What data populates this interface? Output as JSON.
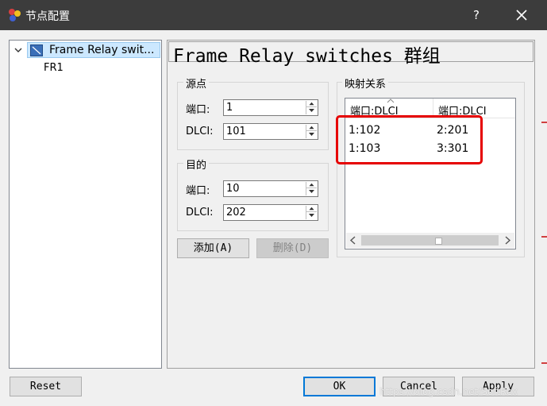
{
  "window": {
    "title": "节点配置",
    "help_label": "?"
  },
  "tree": {
    "root_label": "Frame Relay swit...",
    "child_label": "FR1"
  },
  "header": {
    "title": "Frame Relay switches 群组"
  },
  "source_group": {
    "title": "源点",
    "port_label": "端口:",
    "port_value": "1",
    "dlci_label": "DLCI:",
    "dlci_value": "101"
  },
  "dest_group": {
    "title": "目的",
    "port_label": "端口:",
    "port_value": "10",
    "dlci_label": "DLCI:",
    "dlci_value": "202"
  },
  "actions": {
    "add_label": "添加(A)",
    "delete_label": "删除(D)"
  },
  "mapping": {
    "title": "映射关系",
    "columns": [
      "端口:DLCI",
      "端口:DLCI"
    ],
    "rows": [
      [
        "1:102",
        "2:201"
      ],
      [
        "1:103",
        "3:301"
      ]
    ]
  },
  "footer": {
    "reset_label": "Reset",
    "ok_label": "OK",
    "cancel_label": "Cancel",
    "apply_label": "Apply"
  },
  "watermark": "https://blog.csdn.net/SoftRex",
  "colors": {
    "titlebar": "#3c3c3c",
    "selection": "#cce8ff",
    "highlight": "#e60000",
    "default_button_border": "#0078d7"
  }
}
